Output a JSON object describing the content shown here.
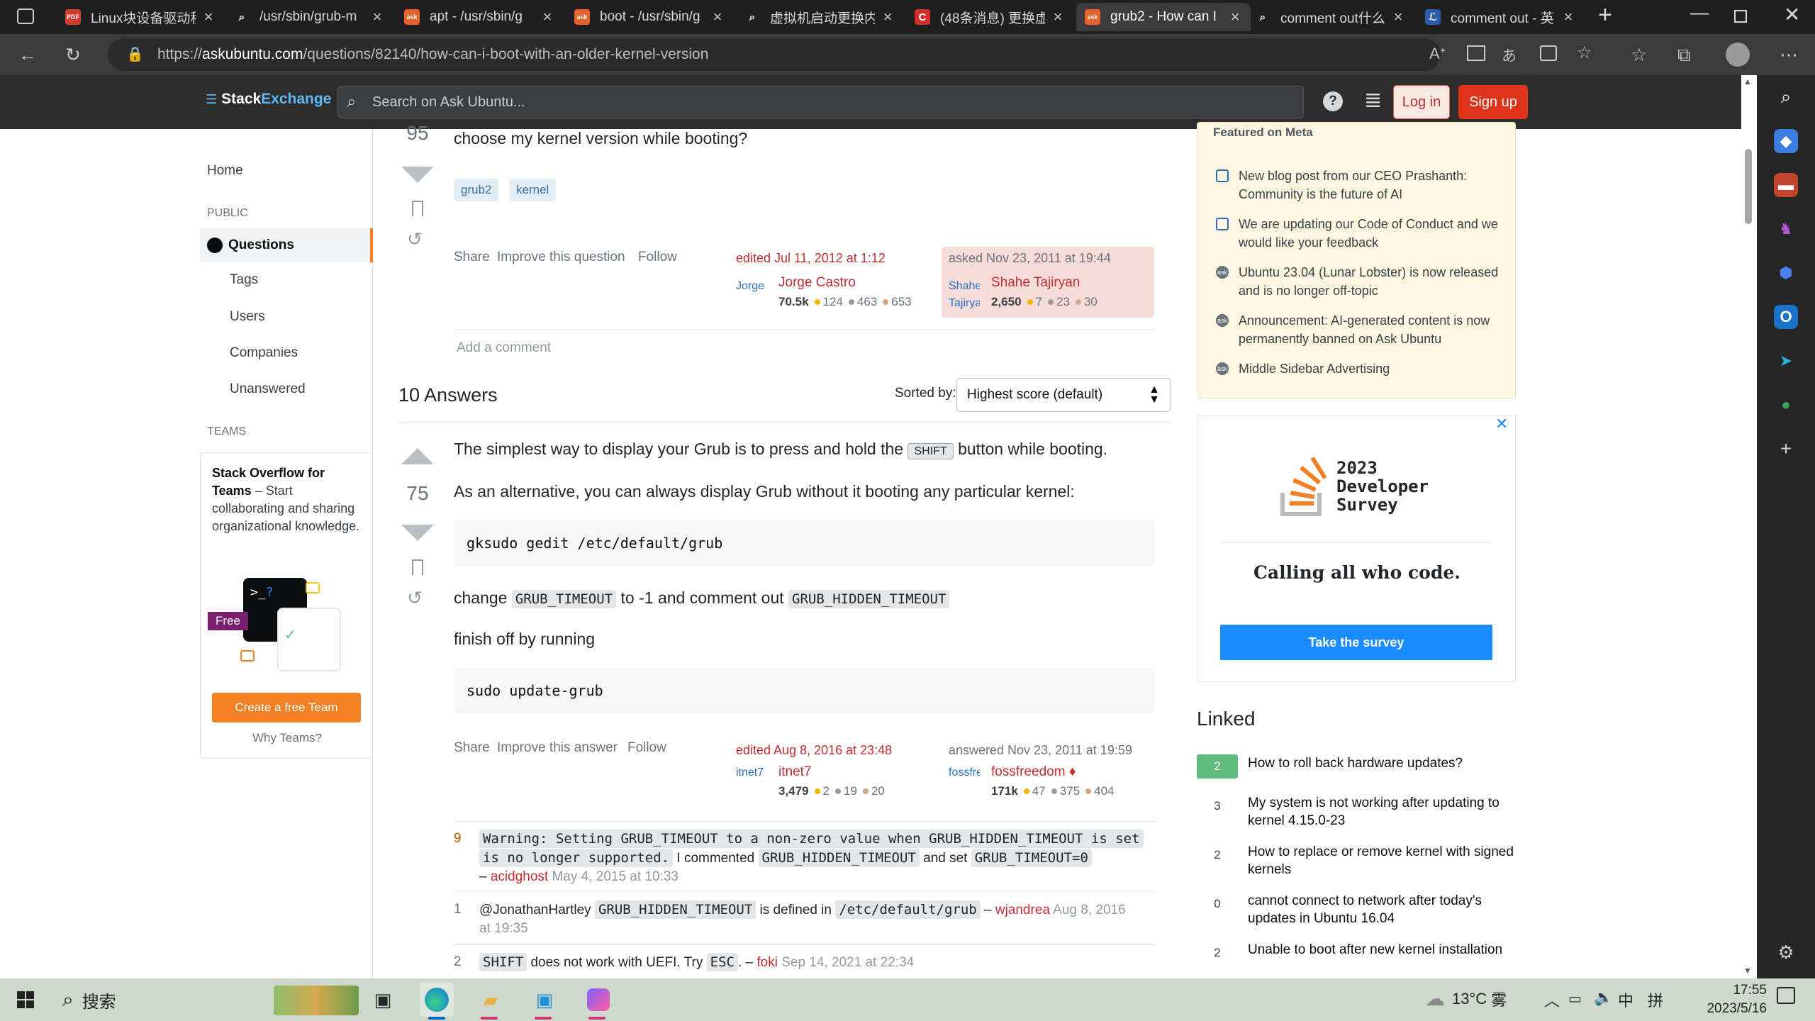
{
  "browser": {
    "tabs": [
      {
        "title": "Linux块设备驱动程",
        "fav_color": "#d33b2c",
        "fav_text": "PDF"
      },
      {
        "title": "/usr/sbin/grub-m",
        "fav_color": "#1f1f1f",
        "fav_text": "⌕"
      },
      {
        "title": "apt - /usr/sbin/g",
        "fav_color": "#e8602c",
        "fav_text": "ask"
      },
      {
        "title": "boot - /usr/sbin/g",
        "fav_color": "#e8602c",
        "fav_text": "ask"
      },
      {
        "title": "虚拟机启动更换内",
        "fav_color": "#1f1f1f",
        "fav_text": "⌕"
      },
      {
        "title": "(48条消息) 更换虚",
        "fav_color": "#d32f2f",
        "fav_text": "C"
      },
      {
        "title": "grub2 - How can I",
        "fav_color": "#e8602c",
        "fav_text": "ask"
      },
      {
        "title": "comment out什么",
        "fav_color": "#1f1f1f",
        "fav_text": "⌕"
      },
      {
        "title": "comment out - 英",
        "fav_color": "#2a5caa",
        "fav_text": "ℒ"
      }
    ],
    "url_prefix": "https://",
    "url_host": "askubuntu.com",
    "url_path": "/questions/82140/how-can-i-boot-with-an-older-kernel-version"
  },
  "header": {
    "logo_stack": "Stack",
    "logo_exchange": "Exchange",
    "search_placeholder": "Search on Ask Ubuntu...",
    "login": "Log in",
    "signup": "Sign up"
  },
  "nav": {
    "home": "Home",
    "public": "PUBLIC",
    "questions": "Questions",
    "tags": "Tags",
    "users": "Users",
    "companies": "Companies",
    "unanswered": "Unanswered",
    "teams": "TEAMS",
    "teams_title": "Stack Overflow for Teams",
    "teams_desc": " – Start collaborating and sharing organizational knowledge.",
    "teams_free": "Free",
    "teams_button": "Create a free Team",
    "teams_why": "Why Teams?"
  },
  "question": {
    "score": "95",
    "text": "choose my kernel version while booting?",
    "tags": [
      "grub2",
      "kernel"
    ],
    "menu": [
      "Share",
      "Improve this question",
      "Follow"
    ],
    "edited": {
      "label": "edited Jul 11, 2012 at 1:12",
      "avatar": "Jorge",
      "name": "Jorge Castro",
      "rep": "70.5k",
      "gold": "124",
      "silver": "463",
      "bronze": "653"
    },
    "asked": {
      "label": "asked Nov 23, 2011 at 19:44",
      "avatar": "Shahe Tajiryan",
      "name": "Shahe Tajiryan",
      "rep": "2,650",
      "gold": "7",
      "silver": "23",
      "bronze": "30"
    },
    "add_comment": "Add a comment"
  },
  "answers": {
    "count_label": "10 Answers",
    "sorted_by": "Sorted by:",
    "sort_value": "Highest score (default)",
    "score": "75",
    "p1_a": "The simplest way to display your Grub is to press and hold the",
    "p1_key": "SHIFT",
    "p1_b": "button while booting.",
    "p2": "As an alternative, you can always display Grub without it booting any particular kernel:",
    "code1": "gksudo gedit /etc/default/grub",
    "p3_a": "change",
    "p3_code1": "GRUB_TIMEOUT",
    "p3_b": "to -1 and comment out",
    "p3_code2": "GRUB_HIDDEN_TIMEOUT",
    "p4": "finish off by running",
    "code2": "sudo update-grub",
    "menu": [
      "Share",
      "Improve this answer",
      "Follow"
    ],
    "edited": {
      "label": "edited Aug 8, 2016 at 23:48",
      "avatar": "itnet7",
      "name": "itnet7",
      "rep": "3,479",
      "gold": "2",
      "silver": "19",
      "bronze": "20"
    },
    "answered": {
      "label": "answered Nov 23, 2011 at 19:59",
      "avatar": "fossfreedom",
      "name": "fossfreedom",
      "mod": "♦",
      "rep": "171k",
      "gold": "47",
      "silver": "375",
      "bronze": "404"
    }
  },
  "comments": [
    {
      "score": "9",
      "code1": "Warning: Setting GRUB_TIMEOUT to a non-zero value when GRUB_HIDDEN_TIMEOUT is set",
      "code1b": "is no longer supported.",
      "t1": " I commented ",
      "code2": "GRUB_HIDDEN_TIMEOUT",
      "t2": " and set ",
      "code3": "GRUB_TIMEOUT=0",
      "dash": "– ",
      "user": "acidghost",
      "date": " May 4, 2015 at 10:33"
    },
    {
      "score": "1",
      "t0": "@JonathanHartley ",
      "code1": "GRUB_HIDDEN_TIMEOUT",
      "t1": " is defined in ",
      "code2": "/etc/default/grub",
      "dash": " – ",
      "user": "wjandrea",
      "date": " Aug 8, 2016",
      "date2": "at 19:35"
    },
    {
      "score": "2",
      "code1": "SHIFT",
      "t1": " does not work with UEFI. Try ",
      "code2": "ESC",
      "t2": ". – ",
      "user": "foki",
      "date": " Sep 14, 2021 at 22:34"
    }
  ],
  "meta": {
    "title": "Featured on Meta",
    "items": [
      "New blog post from our CEO Prashanth: Community is the future of AI",
      "We are updating our Code of Conduct and we would like your feedback",
      "Ubuntu 23.04 (Lunar Lobster) is now released and is no longer off-topic",
      "Announcement: AI-generated content is now permanently banned on Ask Ubuntu",
      "Middle Sidebar Advertising"
    ]
  },
  "ad": {
    "line1": "2023",
    "line2": "Developer",
    "line3": "Survey",
    "tagline": "Calling all who code.",
    "button": "Take the survey"
  },
  "linked": {
    "title": "Linked",
    "items": [
      {
        "score": "2",
        "accepted": true,
        "text": "How to roll back hardware updates?"
      },
      {
        "score": "3",
        "accepted": false,
        "text": "My system is not working after updating to kernel 4.15.0-23"
      },
      {
        "score": "2",
        "accepted": false,
        "text": "How to replace or remove kernel with signed kernels"
      },
      {
        "score": "0",
        "accepted": false,
        "text": "cannot connect to network after today's updates in Ubuntu 16.04"
      },
      {
        "score": "2",
        "accepted": false,
        "text": "Unable to boot after new kernel installation"
      }
    ]
  },
  "taskbar": {
    "search": "搜索",
    "weather": "13°C",
    "weather_desc": "雾",
    "ime1": "中",
    "ime2": "拼",
    "time": "17:55",
    "date": "2023/5/16"
  },
  "colors": {
    "accent_orange": "#f48225",
    "link_red": "#c22e32",
    "signup": "#e0331a",
    "survey_blue": "#1a8cff"
  }
}
